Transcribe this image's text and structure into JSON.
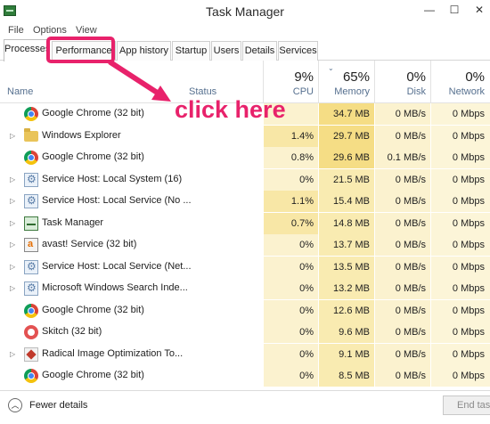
{
  "window": {
    "title": "Task Manager",
    "minimize": "—",
    "maximize": "☐",
    "close": "✕"
  },
  "menu": [
    "File",
    "Options",
    "View"
  ],
  "tabs": [
    "Processes",
    "Performance",
    "App history",
    "Startup",
    "Users",
    "Details",
    "Services"
  ],
  "columns": {
    "name": "Name",
    "status": "Status",
    "cpu": {
      "pct": "9%",
      "label": "CPU"
    },
    "memory": {
      "pct": "65%",
      "label": "Memory"
    },
    "disk": {
      "pct": "0%",
      "label": "Disk"
    },
    "network": {
      "pct": "0%",
      "label": "Network"
    }
  },
  "processes": [
    {
      "name": "Google Chrome (32 bit)",
      "icon": "chrome-icon",
      "expandable": false,
      "cpu": "",
      "memory": "34.7 MB",
      "disk": "0 MB/s",
      "network": "0 Mbps"
    },
    {
      "name": "Windows Explorer",
      "icon": "folder-icon",
      "expandable": true,
      "cpu": "1.4%",
      "memory": "29.7 MB",
      "disk": "0 MB/s",
      "network": "0 Mbps"
    },
    {
      "name": "Google Chrome (32 bit)",
      "icon": "chrome-icon",
      "expandable": false,
      "cpu": "0.8%",
      "memory": "29.6 MB",
      "disk": "0.1 MB/s",
      "network": "0 Mbps"
    },
    {
      "name": "Service Host: Local System (16)",
      "icon": "gear-icon",
      "expandable": true,
      "cpu": "0%",
      "memory": "21.5 MB",
      "disk": "0 MB/s",
      "network": "0 Mbps"
    },
    {
      "name": "Service Host: Local Service (No ...",
      "icon": "gear-icon",
      "expandable": true,
      "cpu": "1.1%",
      "memory": "15.4 MB",
      "disk": "0 MB/s",
      "network": "0 Mbps"
    },
    {
      "name": "Task Manager",
      "icon": "task-manager-icon",
      "expandable": true,
      "cpu": "0.7%",
      "memory": "14.8 MB",
      "disk": "0 MB/s",
      "network": "0 Mbps"
    },
    {
      "name": "avast! Service (32 bit)",
      "icon": "avast-icon",
      "expandable": true,
      "cpu": "0%",
      "memory": "13.7 MB",
      "disk": "0 MB/s",
      "network": "0 Mbps"
    },
    {
      "name": "Service Host: Local Service (Net...",
      "icon": "gear-icon",
      "expandable": true,
      "cpu": "0%",
      "memory": "13.5 MB",
      "disk": "0 MB/s",
      "network": "0 Mbps"
    },
    {
      "name": "Microsoft Windows Search Inde...",
      "icon": "search-indexer-icon",
      "expandable": true,
      "cpu": "0%",
      "memory": "13.2 MB",
      "disk": "0 MB/s",
      "network": "0 Mbps"
    },
    {
      "name": "Google Chrome (32 bit)",
      "icon": "chrome-icon",
      "expandable": false,
      "cpu": "0%",
      "memory": "12.6 MB",
      "disk": "0 MB/s",
      "network": "0 Mbps"
    },
    {
      "name": "Skitch (32 bit)",
      "icon": "skitch-icon",
      "expandable": false,
      "cpu": "0%",
      "memory": "9.6 MB",
      "disk": "0 MB/s",
      "network": "0 Mbps"
    },
    {
      "name": "Radical Image Optimization To...",
      "icon": "rio-icon",
      "expandable": true,
      "cpu": "0%",
      "memory": "9.1 MB",
      "disk": "0 MB/s",
      "network": "0 Mbps"
    },
    {
      "name": "Google Chrome (32 bit)",
      "icon": "chrome-icon",
      "expandable": false,
      "cpu": "0%",
      "memory": "8.5 MB",
      "disk": "0 MB/s",
      "network": "0 Mbps"
    }
  ],
  "footer": {
    "fewer_details": "Fewer details",
    "end_task": "End task"
  },
  "annotation": {
    "text": "click here",
    "color": "#e8226b"
  },
  "colors": {
    "cpu_bg": "#fbf2cf",
    "cpu_bg_hot": "#f8e7a6",
    "mem_bg": "#f9ebb1",
    "mem_bg_hot": "#f5dd85",
    "disk_bg": "#fbf2cf",
    "net_bg": "#fcf5d8"
  }
}
